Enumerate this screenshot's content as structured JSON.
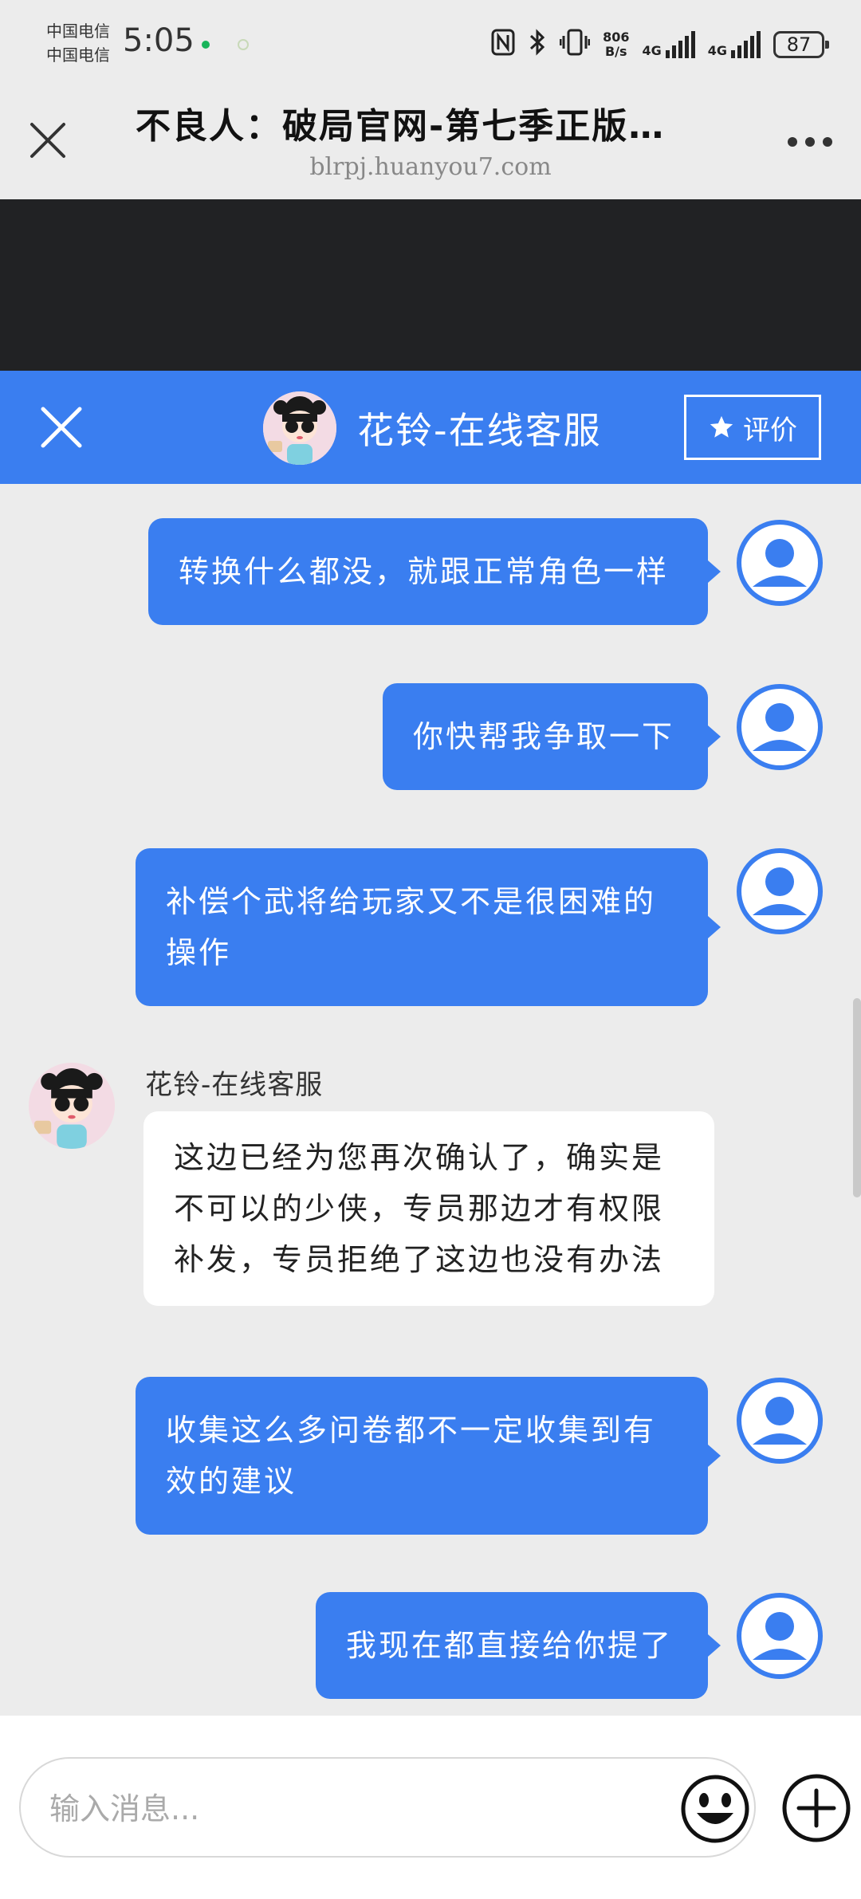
{
  "status_bar": {
    "carrier_1": "中国电信",
    "carrier_2": "中国电信",
    "time": "5:05",
    "net_speed_value": "806",
    "net_speed_unit": "B/s",
    "sim1_network": "4G",
    "sim2_network": "4G",
    "battery": "87",
    "icons": [
      "nfc-icon",
      "bluetooth-icon",
      "vibrate-icon",
      "wifi-icon"
    ]
  },
  "browser": {
    "page_title": "不良人：破局官网-第七季正版…",
    "url": "blrpj.huanyou7.com"
  },
  "chat_header": {
    "agent_name": "花铃-在线客服",
    "rate_label": "评价",
    "accent_color": "#3a7ef0"
  },
  "messages": [
    {
      "from": "user",
      "text": "转换什么都没，就跟正常角色一样"
    },
    {
      "from": "user",
      "text": "你快帮我争取一下"
    },
    {
      "from": "user",
      "lines": [
        "补偿个武将给玩家又不是很困难的",
        "操作"
      ]
    },
    {
      "from": "agent",
      "sender": "花铃-在线客服",
      "lines": [
        "这边已经为您再次确认了，确实是",
        "不可以的少侠，专员那边才有权限",
        "补发，专员拒绝了这边也没有办法"
      ]
    },
    {
      "from": "user",
      "lines": [
        "收集这么多问卷都不一定收集到有",
        "效的建议"
      ]
    },
    {
      "from": "user",
      "text": "我现在都直接给你提了"
    }
  ],
  "composer": {
    "placeholder": "输入消息..."
  }
}
